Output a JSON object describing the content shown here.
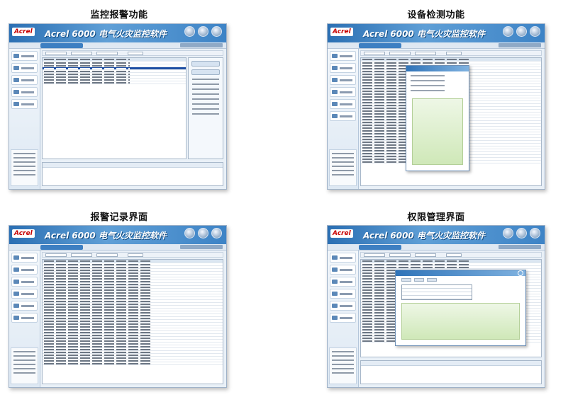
{
  "panels": [
    {
      "id": "monitor",
      "title": "监控报警功能",
      "brand": "Acrel 6000 电气火灾监控软件",
      "logo": "Acrel"
    },
    {
      "id": "device",
      "title": "设备检测功能",
      "brand": "Acrel 6000 电气火灾监控软件",
      "logo": "Acrel"
    },
    {
      "id": "records",
      "title": "报警记录界面",
      "brand": "Acrel 6000 电气火灾监控软件",
      "logo": "Acrel"
    },
    {
      "id": "rights",
      "title": "权限管理界面",
      "brand": "Acrel 6000 电气火灾监控软件",
      "logo": "Acrel"
    }
  ],
  "colors": {
    "header_blue": "#2b6fb3",
    "selection_blue": "#1e4fa3",
    "logo_red": "#c80000",
    "dialog_green": "#cfe8b8"
  }
}
